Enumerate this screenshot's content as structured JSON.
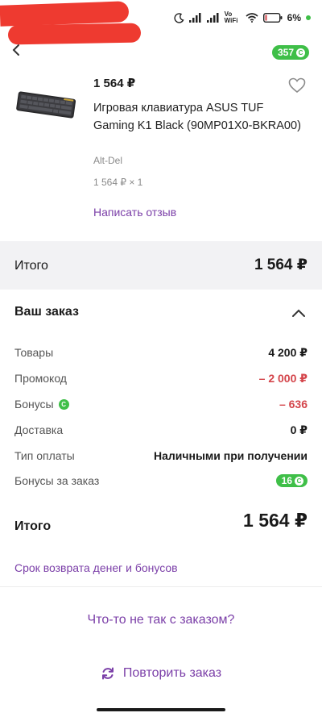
{
  "status_bar": {
    "network_label": "Vo WiFi",
    "battery": "6%",
    "icons": [
      "moon-icon",
      "signal-icon",
      "signal-icon",
      "wifi-icon",
      "battery-icon"
    ]
  },
  "header": {
    "bonus_balance": "357"
  },
  "product": {
    "price": "1 564 ₽",
    "title": "Игровая клавиатура ASUS TUF Gaming K1 Black (90MP01X0-BKRA00)",
    "seller": "Alt-Del",
    "qty_line": "1 564 ₽ × 1",
    "review_link": "Написать отзыв"
  },
  "total_band": {
    "label": "Итого",
    "value": "1 564 ₽"
  },
  "order": {
    "title": "Ваш заказ",
    "rows": [
      {
        "label": "Товары",
        "value": "4 200 ₽"
      },
      {
        "label": "Промокод",
        "value": "– 2 000 ₽"
      },
      {
        "label": "Бонусы",
        "value": "– 636"
      },
      {
        "label": "Доставка",
        "value": "0 ₽"
      },
      {
        "label": "Тип оплаты",
        "value": "Наличными при получении"
      },
      {
        "label": "Бонусы за заказ",
        "value": "16"
      }
    ],
    "final_label": "Итого",
    "final_value": "1 564 ₽"
  },
  "links": {
    "refund": "Срок возврата денег и бонусов",
    "problem": "Что-то не так с заказом?",
    "repeat": "Повторить заказ"
  },
  "colors": {
    "accent": "#7b3fa8",
    "bonus_green": "#3fbf48",
    "negative": "#d4454b"
  }
}
